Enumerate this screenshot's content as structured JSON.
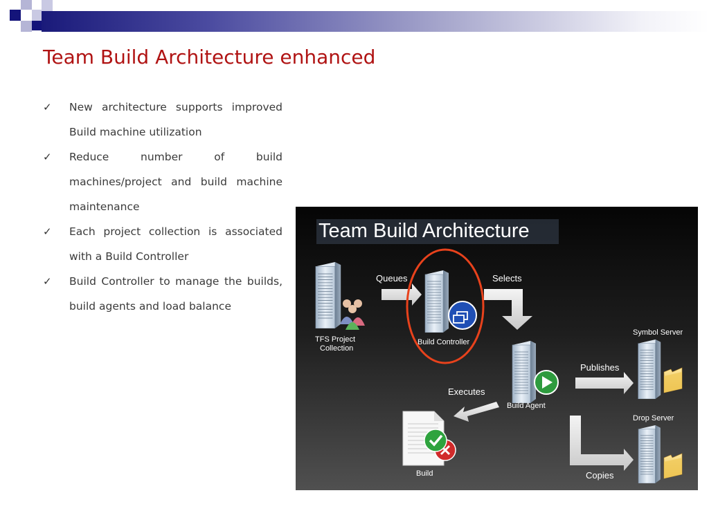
{
  "slide": {
    "title": "Team Build Architecture enhanced",
    "bullets": [
      "New architecture supports improved Build machine utilization",
      "Reduce number of build machines/project and build machine maintenance",
      "Each project collection is associated with a Build Controller",
      "Build Controller to manage the builds, build agents and load balance"
    ]
  },
  "diagram": {
    "title": "Team Build Architecture",
    "tfs_line1": "TFS  Project",
    "tfs_line2": "Collection",
    "build_controller": "Build Controller",
    "build_agent": "Build Agent",
    "build": "Build",
    "symbol_server": "Symbol Server",
    "drop_server": "Drop Server",
    "queues": "Queues",
    "selects": "Selects",
    "publishes": "Publishes",
    "executes": "Executes",
    "copies": "Copies"
  },
  "colors": {
    "title": "#b01313",
    "highlight": "#e8421c",
    "banner": "#14147a"
  },
  "icons": {
    "bullet": "checkmark-icon",
    "server": "server-icon",
    "users": "users-icon",
    "folder": "folder-icon",
    "document": "document-icon"
  }
}
